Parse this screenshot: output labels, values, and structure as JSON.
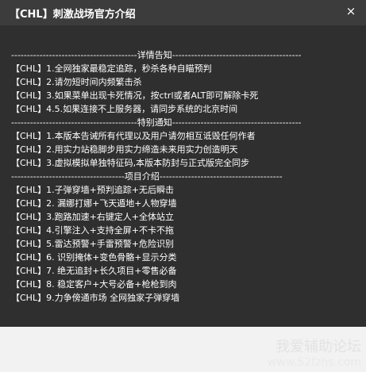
{
  "window": {
    "title": "【CHL】刺激战场官方介绍",
    "close_glyph": "×"
  },
  "content": {
    "lines": [
      "----------------------------------------详情告知-----------------------------------------",
      "【CHL】1.全网独家最稳定追踪，秒杀各种自瞄预判",
      "【CHL】2.请勿短时间内频繁击杀",
      "【CHL】3.如果菜单出现卡死情况，按ctrl或者ALT即可解除卡死",
      "【CHL】4.5.如果连接不上服务器，请同步系统的北京时间",
      "----------------------------------------特别通知-----------------------------------------",
      "【CHL】1.本版本告诫所有代理以及用户请勿相互诋毁任何作者",
      "【CHL】2.用实力站稳脚步用实力缔造未来用实力创造明天",
      "【CHL】3.虚拟模拟单独特征码,本版本防封与正式版完全同步",
      "------------------------------------项目介绍---------------------------------------",
      "【CHL】1.子弹穿墙+预判追踪+无后瞬击",
      "【CHL】2. 漏娜打娜+飞天遁地+人物穿墙",
      "【CHL】3.跑路加速+右键定人+全体站立",
      "【CHL】4.引擎注入+支持全屏+不卡不拖",
      "【CHL】5.雷达预警+手雷预警+危险识别",
      "【CHL】6. 识别掩体+变色骨骼+显示分类",
      "【CHL】7. 绝无追封+长久项目+零售必备",
      "【CHL】8. 稳定客户+大号必备+枪枪到肉",
      "【CHL】9.力争傍通市场 全网独家子弹穿墙"
    ]
  },
  "watermark": {
    "line1": "我爱辅助论坛",
    "line2": "www.52fzhs.com"
  }
}
